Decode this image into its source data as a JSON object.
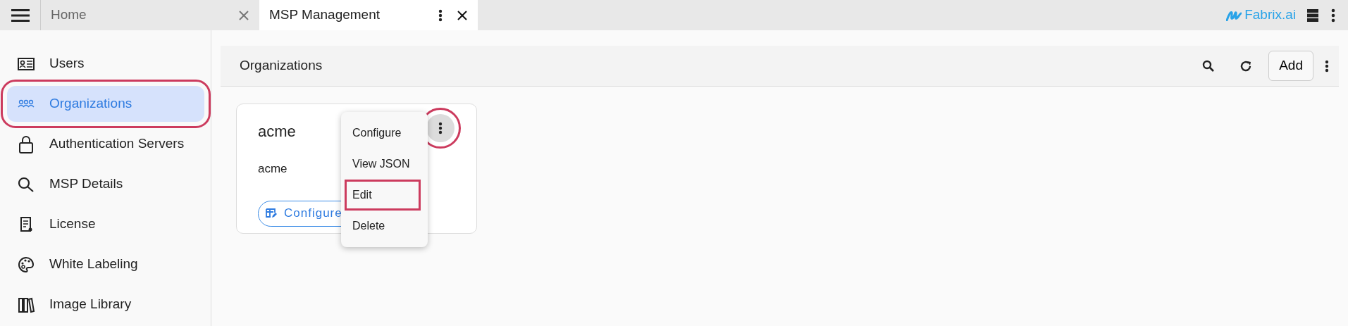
{
  "tabs": [
    {
      "label": "Home",
      "selected": false
    },
    {
      "label": "MSP Management",
      "selected": true
    }
  ],
  "brand": {
    "name": "Fabrix.ai"
  },
  "sidebar": {
    "items": [
      {
        "label": "Users",
        "selected": false,
        "highlighted": false
      },
      {
        "label": "Organizations",
        "selected": true,
        "highlighted": true
      },
      {
        "label": "Authentication Servers",
        "selected": false,
        "highlighted": false
      },
      {
        "label": "MSP Details",
        "selected": false,
        "highlighted": false
      },
      {
        "label": "License",
        "selected": false,
        "highlighted": false
      },
      {
        "label": "White Labeling",
        "selected": false,
        "highlighted": false
      },
      {
        "label": "Image Library",
        "selected": false,
        "highlighted": false
      }
    ]
  },
  "header": {
    "title": "Organizations",
    "add_button": "Add"
  },
  "cards": [
    {
      "title": "acme",
      "subtitle": "acme",
      "button": "Configure",
      "menu_button_highlighted": true,
      "menu": [
        {
          "label": "Configure",
          "highlighted": false
        },
        {
          "label": "View JSON",
          "highlighted": false
        },
        {
          "label": "Edit",
          "highlighted": true
        },
        {
          "label": "Delete",
          "highlighted": false
        }
      ]
    }
  ]
}
